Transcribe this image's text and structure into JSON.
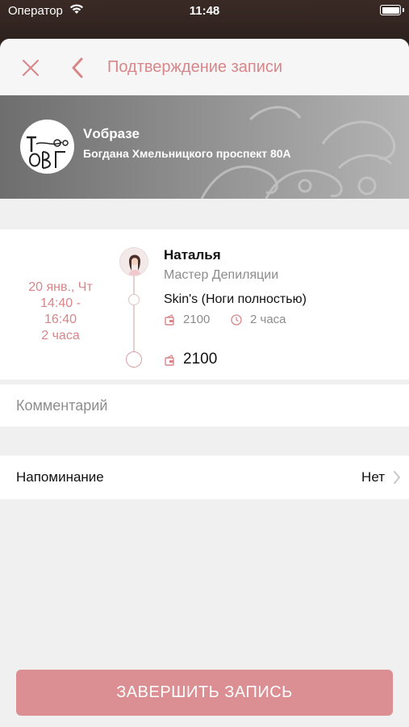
{
  "status_bar": {
    "carrier": "Оператор",
    "time": "11:48"
  },
  "nav": {
    "title": "Подтверждение записи"
  },
  "salon": {
    "name": "Vобразе",
    "address": "Богдана Хмельницкого проспект 80А"
  },
  "appointment": {
    "date": "20 янв., Чт",
    "time_from": "14:40 -",
    "time_to": "16:40",
    "duration": "2 часа",
    "master_name": "Наталья",
    "master_role": "Мастер Депиляции",
    "service_name": "Skin's (Ноги полностью)",
    "service_price": "2100",
    "service_duration": "2 часа",
    "total": "2100"
  },
  "comment": {
    "placeholder": "Комментарий"
  },
  "reminder": {
    "label": "Напоминание",
    "value": "Нет"
  },
  "actions": {
    "finish_label": "ЗАВЕРШИТЬ ЗАПИСЬ"
  },
  "colors": {
    "accent": "#d8868a",
    "button": "#db8f92",
    "background": "#f1f0f0"
  },
  "icons": {
    "close": "close-icon",
    "back": "chevron-left-icon",
    "price": "wallet-icon",
    "duration": "clock-icon",
    "chevron": "chevron-right-icon"
  }
}
